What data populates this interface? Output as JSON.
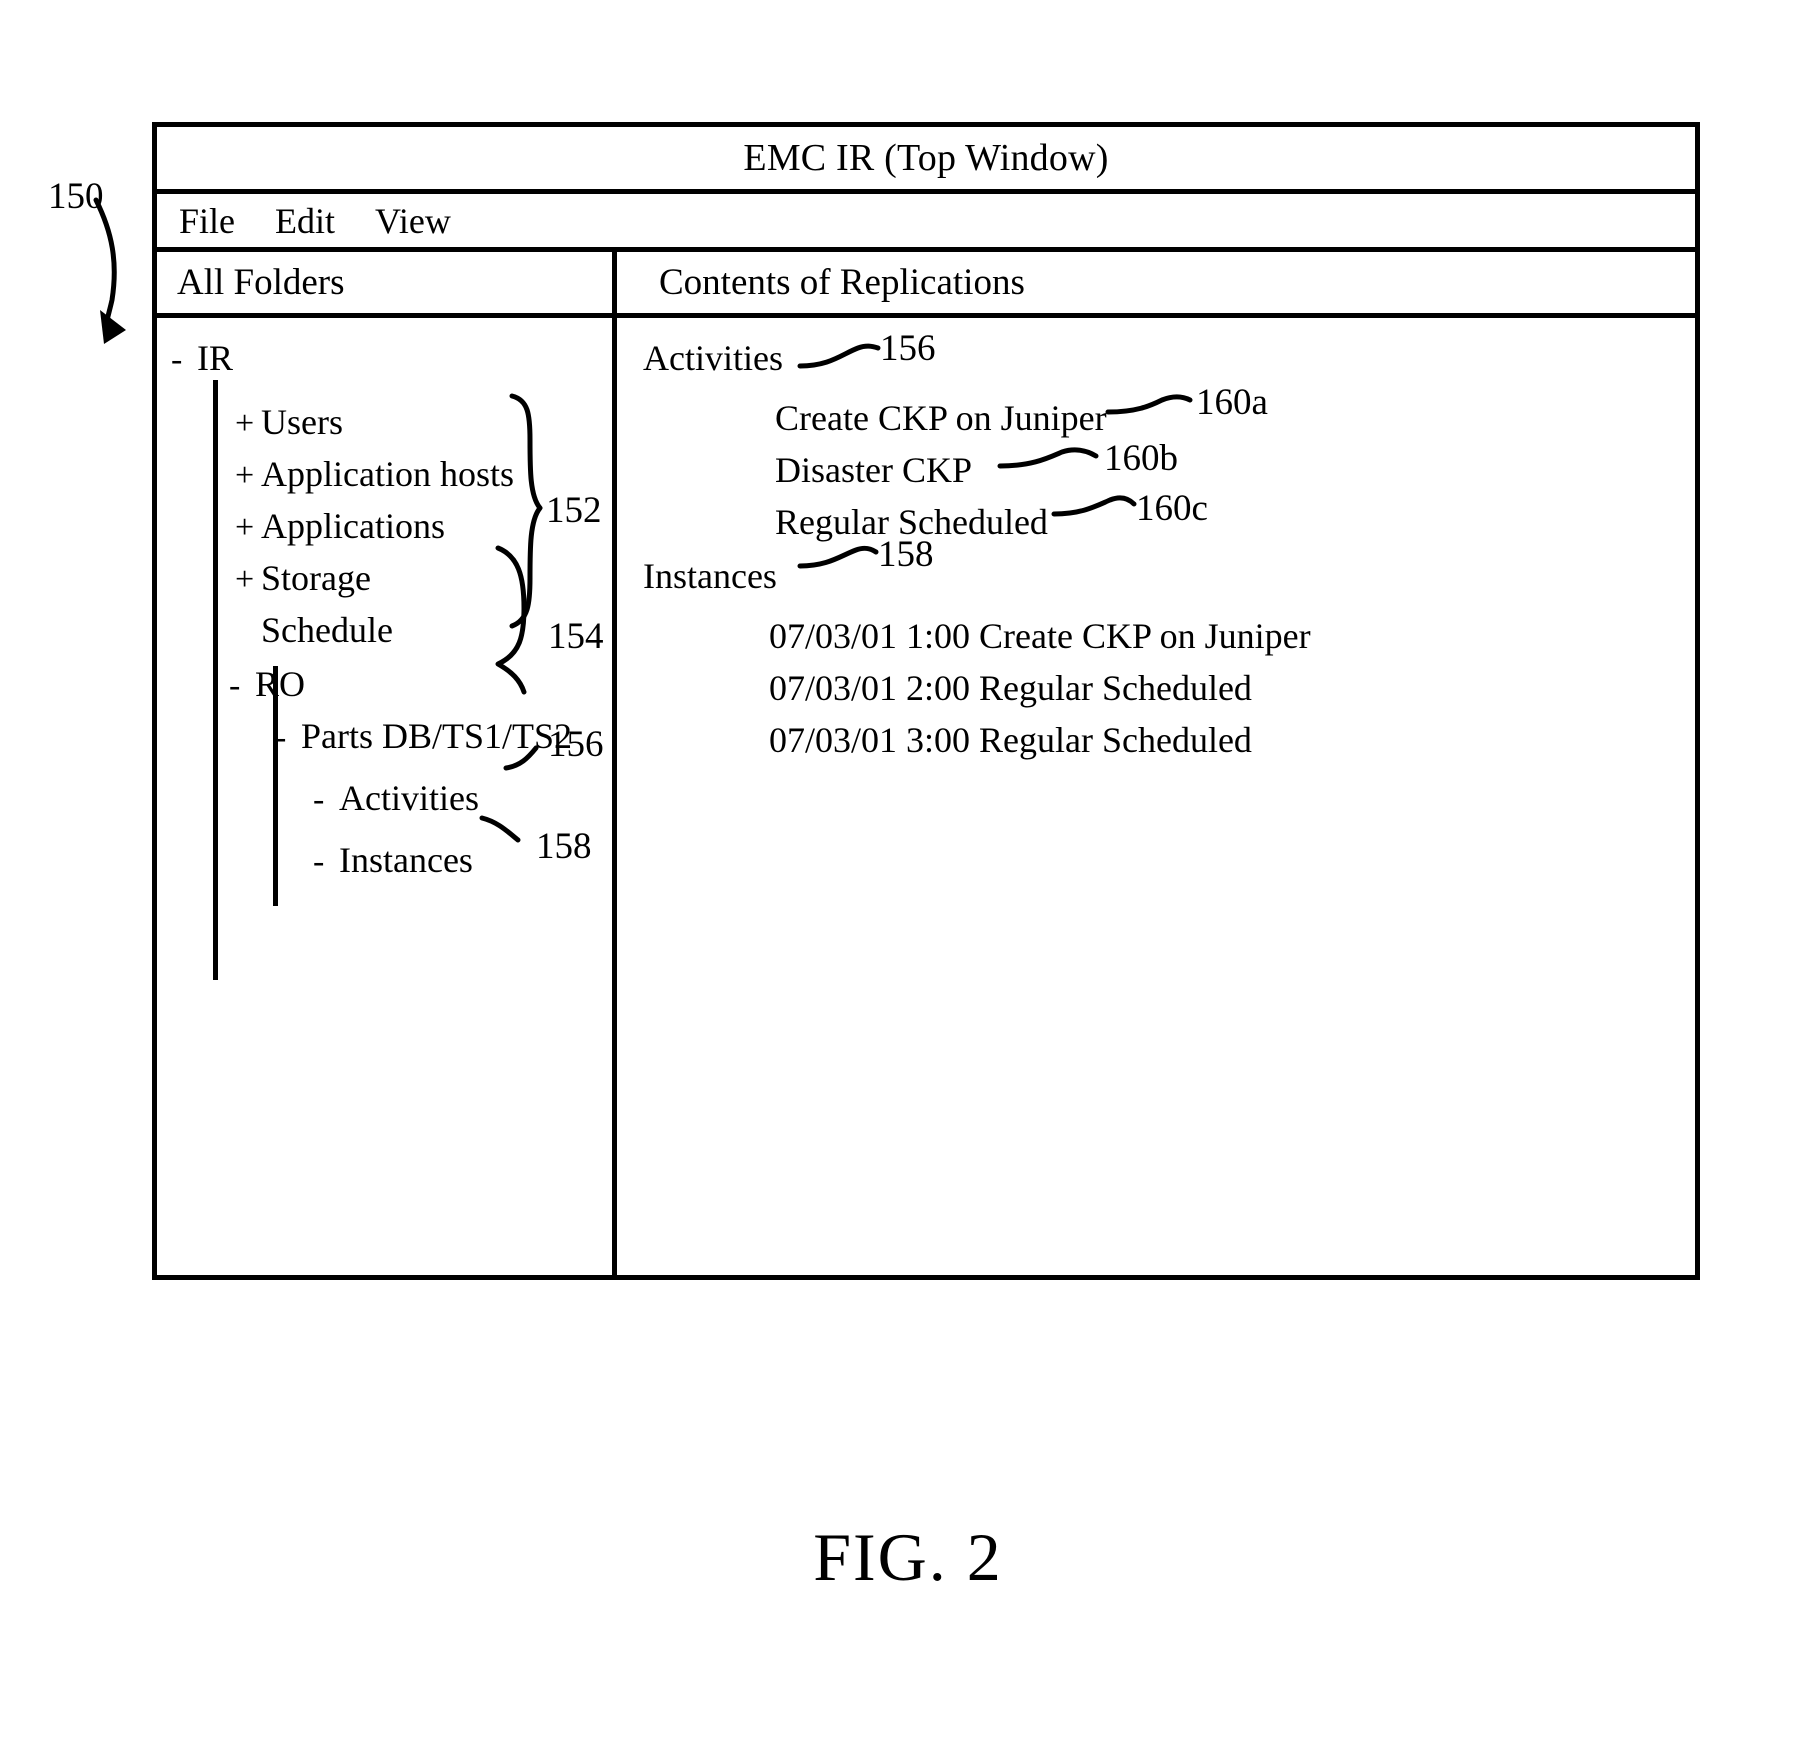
{
  "figure": {
    "caption": "FIG. 2",
    "callouts": {
      "window": "150",
      "folders_brace": "152",
      "ro_brace": "154",
      "activities_tree": "156",
      "instances_tree": "158",
      "contents_activities": "156",
      "contents_instances": "158",
      "activity_a": "160a",
      "activity_b": "160b",
      "activity_c": "160c"
    }
  },
  "window": {
    "title": "EMC IR (Top Window)",
    "menubar": {
      "items": [
        {
          "label": "File"
        },
        {
          "label": "Edit"
        },
        {
          "label": "View"
        }
      ]
    },
    "left_pane": {
      "header": "All Folders",
      "tree": [
        {
          "sign": "-",
          "label": "IR",
          "level": 0
        },
        {
          "sign": "+",
          "label": "Users",
          "level": 1
        },
        {
          "sign": "+",
          "label": "Application hosts",
          "level": 1
        },
        {
          "sign": "+",
          "label": "Applications",
          "level": 1
        },
        {
          "sign": "+",
          "label": "Storage",
          "level": 1
        },
        {
          "sign": "",
          "label": "Schedule",
          "level": 1
        },
        {
          "sign": "-",
          "label": "RO",
          "level": 1
        },
        {
          "sign": "-",
          "label": "Parts DB/TS1/TS2",
          "level": 2
        },
        {
          "sign": "-",
          "label": "Activities",
          "level": 3
        },
        {
          "sign": "-",
          "label": "Instances",
          "level": 3
        }
      ]
    },
    "right_pane": {
      "header": "Contents of Replications",
      "activities_heading": "Activities",
      "activities": [
        {
          "label": "Create CKP on Juniper"
        },
        {
          "label": "Disaster CKP"
        },
        {
          "label": "Regular Scheduled"
        }
      ],
      "instances_heading": "Instances",
      "instances": [
        {
          "label": "07/03/01 1:00 Create CKP on Juniper"
        },
        {
          "label": "07/03/01 2:00 Regular Scheduled"
        },
        {
          "label": "07/03/01 3:00 Regular Scheduled"
        }
      ]
    }
  }
}
